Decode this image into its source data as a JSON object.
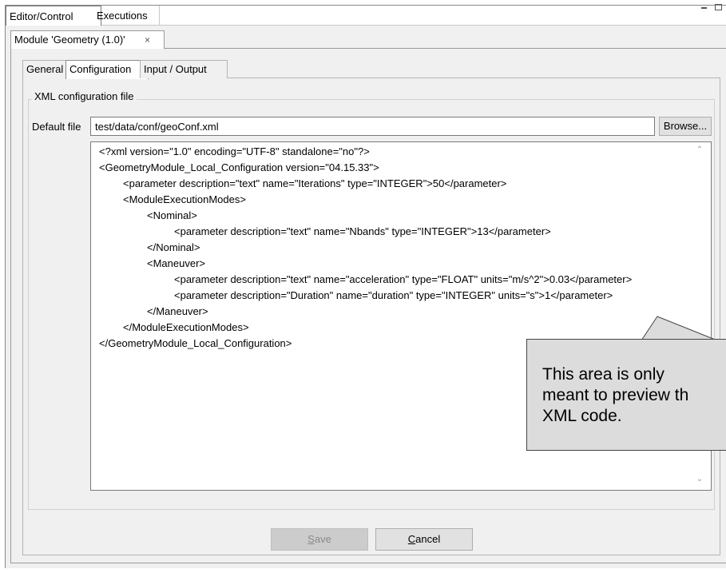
{
  "view_tabs": [
    "Editor/Control",
    "Executions"
  ],
  "module_tab": {
    "label": "Module 'Geometry (1.0)'",
    "close": "×"
  },
  "config_tabs": [
    "General",
    "Configuration",
    "Input / Output"
  ],
  "group": {
    "title": "XML configuration file",
    "default_file_label": "Default file",
    "default_file_value": "test/data/conf/geoConf.xml",
    "browse_label": "Browse..."
  },
  "xml_lines": [
    "<?xml version=\"1.0\" encoding=\"UTF-8\" standalone=\"no\"?>",
    "<GeometryModule_Local_Configuration version=\"04.15.33\">",
    "<parameter description=\"text\" name=\"Iterations\" type=\"INTEGER\">50</parameter>",
    "<ModuleExecutionModes>",
    "<Nominal>",
    "<parameter description=\"text\" name=\"Nbands\" type=\"INTEGER\">13</parameter>",
    "</Nominal>",
    "<Maneuver>",
    "<parameter description=\"text\" name=\"acceleration\" type=\"FLOAT\" units=\"m/s^2\">0.03</parameter>",
    "<parameter description=\"Duration\" name=\"duration\" type=\"INTEGER\" units=\"s\">1</parameter>",
    "</Maneuver>",
    "</ModuleExecutionModes>",
    "</GeometryModule_Local_Configuration>"
  ],
  "callout_text": "This area is only\nmeant to preview th\nXML code.",
  "buttons": {
    "save_first": "S",
    "save_rest": "ave",
    "cancel_first": "C",
    "cancel_rest": "ancel"
  }
}
